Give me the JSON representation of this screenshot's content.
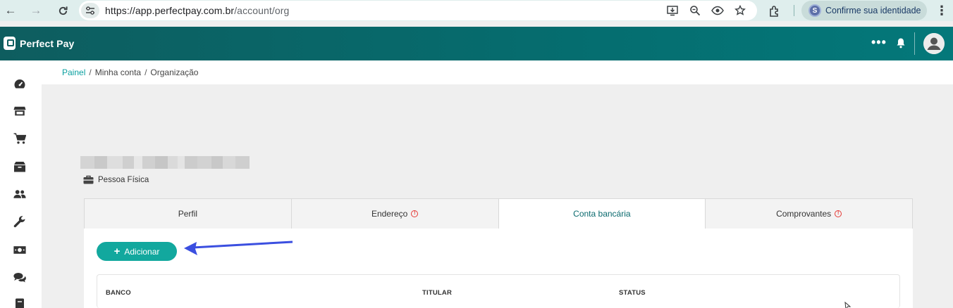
{
  "browser": {
    "back_label": "←",
    "forward_label": "→",
    "reload_label": "↻",
    "url_host": "https://app.perfectpay.com.br",
    "url_path": "/account/org",
    "identity_label": "Confirme sua identidade",
    "identity_badge": "S",
    "menu_label": "⋮"
  },
  "header": {
    "logo_text": "Perfect Pay",
    "more_label": "•••"
  },
  "sidebar": {
    "items": [
      "dashboard-icon",
      "store-icon",
      "cart-icon",
      "box-icon",
      "users-icon",
      "wrench-icon",
      "money-icon",
      "chat-icon",
      "document-icon"
    ]
  },
  "breadcrumb": {
    "root": "Painel",
    "sep1": "/",
    "level1": "Minha conta",
    "sep2": "/",
    "current": "Organização"
  },
  "profile": {
    "person_type": "Pessoa Física"
  },
  "tabs": [
    {
      "label": "Perfil",
      "warning": false,
      "active": false
    },
    {
      "label": "Endereço",
      "warning": true,
      "active": false
    },
    {
      "label": "Conta bancária",
      "warning": false,
      "active": true
    },
    {
      "label": "Comprovantes",
      "warning": true,
      "active": false
    }
  ],
  "bank": {
    "add_label": "Adicionar",
    "columns": [
      "BANCO",
      "TITULAR",
      "STATUS"
    ]
  },
  "colors": {
    "brand": "#056d6f",
    "accent": "#12a89e",
    "warning": "#e53935",
    "annotation_arrow": "#3b4fe0"
  }
}
